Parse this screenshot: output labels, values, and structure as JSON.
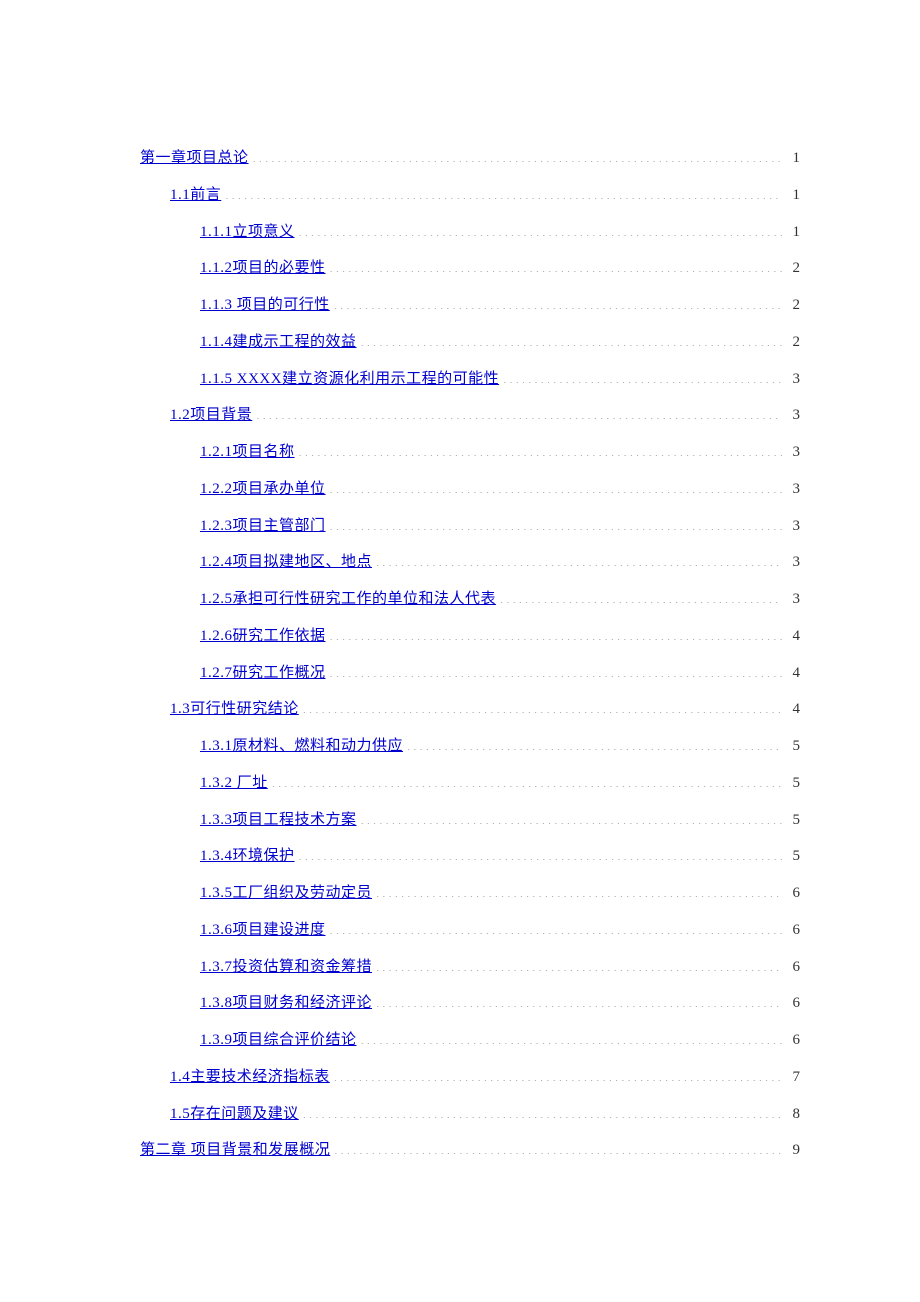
{
  "toc": [
    {
      "level": 1,
      "title": "第一章项目总论",
      "page": "1"
    },
    {
      "level": 2,
      "title": "1.1前言",
      "page": "1"
    },
    {
      "level": 3,
      "title": "1.1.1立项意义",
      "page": "1"
    },
    {
      "level": 3,
      "title": "1.1.2项目的必要性",
      "page": "2"
    },
    {
      "level": 3,
      "title": "1.1.3 项目的可行性",
      "page": "2"
    },
    {
      "level": 3,
      "title": "1.1.4建成示工程的效益",
      "page": "2"
    },
    {
      "level": 3,
      "title": "1.1.5 XXXX建立资源化利用示工程的可能性",
      "page": "3"
    },
    {
      "level": 2,
      "title": "1.2项目背景",
      "page": "3"
    },
    {
      "level": 3,
      "title": "1.2.1项目名称",
      "page": "3"
    },
    {
      "level": 3,
      "title": "1.2.2项目承办单位",
      "page": "3"
    },
    {
      "level": 3,
      "title": "1.2.3项目主管部门",
      "page": "3"
    },
    {
      "level": 3,
      "title": "1.2.4项目拟建地区、地点",
      "page": "3"
    },
    {
      "level": 3,
      "title": "1.2.5承担可行性研究工作的单位和法人代表",
      "page": "3"
    },
    {
      "level": 3,
      "title": "1.2.6研究工作依据",
      "page": "4"
    },
    {
      "level": 3,
      "title": "1.2.7研究工作概况",
      "page": "4"
    },
    {
      "level": 2,
      "title": "1.3可行性研究结论",
      "page": "4"
    },
    {
      "level": 3,
      "title": "1.3.1原材料、燃料和动力供应",
      "page": "5"
    },
    {
      "level": 3,
      "title": "1.3.2 厂址",
      "page": "5"
    },
    {
      "level": 3,
      "title": "1.3.3项目工程技术方案",
      "page": "5"
    },
    {
      "level": 3,
      "title": "1.3.4环境保护",
      "page": "5"
    },
    {
      "level": 3,
      "title": "1.3.5工厂组织及劳动定员",
      "page": "6"
    },
    {
      "level": 3,
      "title": "1.3.6项目建设进度",
      "page": "6"
    },
    {
      "level": 3,
      "title": "1.3.7投资估算和资金筹措",
      "page": "6"
    },
    {
      "level": 3,
      "title": "1.3.8项目财务和经济评论",
      "page": "6"
    },
    {
      "level": 3,
      "title": "1.3.9项目综合评价结论",
      "page": "6"
    },
    {
      "level": 2,
      "title": "1.4主要技术经济指标表",
      "page": "7"
    },
    {
      "level": 2,
      "title": "1.5存在问题及建议",
      "page": "8"
    },
    {
      "level": 1,
      "title": "第二章 项目背景和发展概况",
      "page": "9"
    }
  ]
}
